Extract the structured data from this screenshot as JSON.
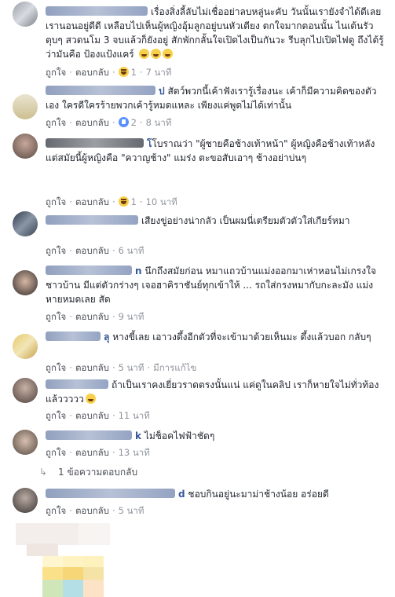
{
  "actions": {
    "like": "ถูกใจ",
    "reply": "ตอบกลับ",
    "sep": "·"
  },
  "comments": [
    {
      "text": "เรื่องสิ่งลี้ลับไม่เชื่ออย่าลบหลู่นะคับ วันนั้นเรายังจำได้ดีเลยเรานอนอยู่ดีดี เหลือบไปเห็นผู้หญิงอุ้มลูกอยู่บนหัวเตียง ตกใจมากตอนนั้น ไนเต้นรัวตุบๆ สวดนโม 3 จบแล้วก็ยังอยู่ สักพักกลั้นใจเปิดไงเป็นกันวะ รีบลุกไปเปิดไฟดู ถึงได้รู้ว่ามันคือ ป้องแป้งแคร์",
      "reaction": "haha",
      "count": "1",
      "time": "7 นาที",
      "edited": ""
    },
    {
      "name_tail": "ป",
      "text": "สัตว์พวกนี้เค้าฟังเรารู้เรื่องนะ เค้าก็มีความคิดของตัวเอง ใครดีใครร้ายพวกเค้ารู้หมดแหละ เพียงแค่พูดไม่ได้เท่านั้น",
      "reaction": "like",
      "count": "2",
      "time": "8 นาที",
      "edited": ""
    },
    {
      "name_tail": "โ",
      "text": "โบราณว่า \"ผู้ชายคือช้างเท้าหน้า\" ผู้หญิงคือช้างเท้าหลัง แต่สมัยนี้ผู้หญิงคือ \"ควาญช้าง\" แมร่ง ตะขอสับเอาๆ ช้างอย่าบ่นๆ",
      "reaction": "haha",
      "count": "1",
      "time": "10 นาที",
      "edited": ""
    },
    {
      "text": "เสียงขู่อย่างน่ากลัว เป็นผมนี่เตรียมตัวตัวใส่เกียร์หมา",
      "reaction": "",
      "count": "",
      "time": "6 นาที",
      "edited": ""
    },
    {
      "name_tail": "n",
      "text": "นึกถึงสมัยก่อน หมาแถวบ้านแม่งออกมาเห่าหอนไม่เกรงใจชาวบ้าน มีแต่ตัวกร่างๆ เจอฮาคิราชันย์ทุกเข้าให้ ... รถใส่กรงหมากับกะละมัง แม่งหายหมดเลย สัด",
      "reaction": "",
      "count": "",
      "time": "9 นาที",
      "edited": ""
    },
    {
      "name_tail": "ลุ",
      "text": "หางขี้เลย เอาวงดึ้งอีกตัวที่จะเข้ามาด้วยเห็นมะ ดึ้งแล้วบอก กลับๆ",
      "reaction": "",
      "count": "",
      "time": "5 นาที",
      "edited": "มีการแก้ไข"
    },
    {
      "text": "ถ้าเป็นเราคงเยี่ยวราดตรงนั้นแน่ แค่ดูในคลิป เราก็หายใจไม่ทั่วท้องแล้ววววว",
      "reaction": "",
      "count": "",
      "time": "11 นาที",
      "edited": ""
    },
    {
      "name_tail": "k",
      "text": "ไม่ช็อคไฟฟ้าชัดๆ",
      "reaction": "",
      "count": "",
      "time": "13 นาที",
      "edited": ""
    },
    {
      "name_tail": "d",
      "text": "ชอบกินอยู่นะมาม่าช้างน้อย อร่อยดี",
      "reaction": "",
      "count": "",
      "time": "5 นาที",
      "edited": ""
    }
  ],
  "reply_link": "1 ข้อความตอบกลับ"
}
